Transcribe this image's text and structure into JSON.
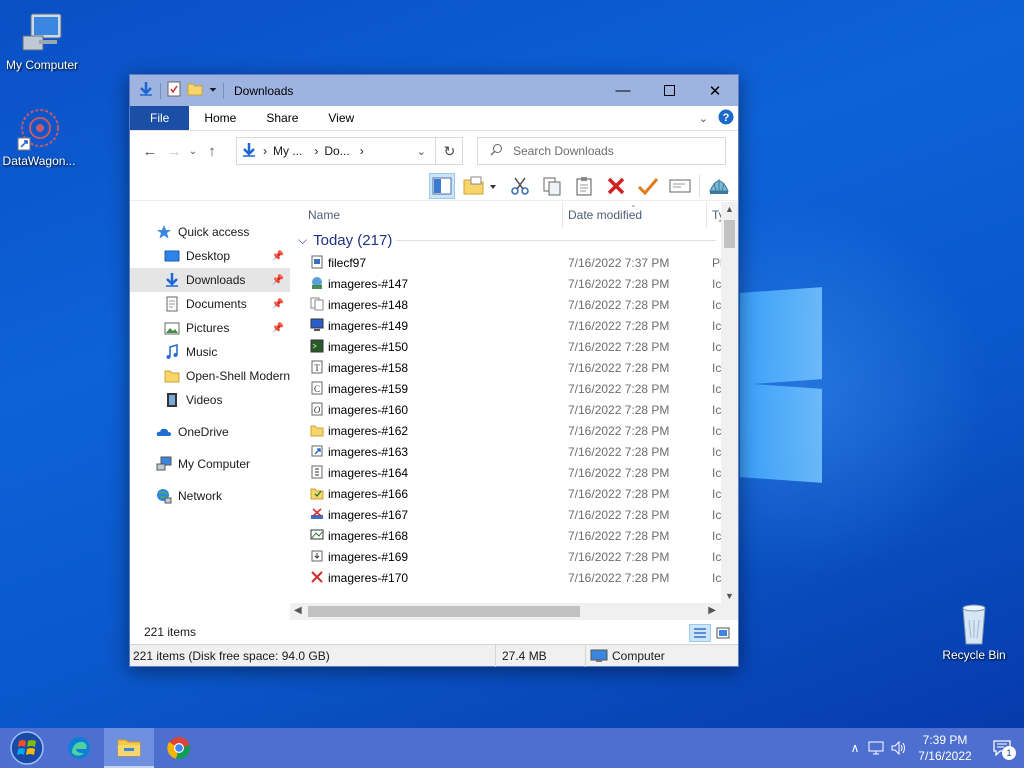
{
  "desktop": {
    "icons": [
      {
        "label": "My Computer"
      },
      {
        "label": "DataWagon..."
      },
      {
        "label": "Recycle Bin"
      }
    ]
  },
  "window": {
    "title": "Downloads",
    "ribbon_tabs": [
      "File",
      "Home",
      "Share",
      "View"
    ],
    "address": {
      "crumb1": "My ...",
      "crumb2": "Do...",
      "sep": "›"
    },
    "search_placeholder": "Search Downloads",
    "nav": {
      "quick_access": "Quick access",
      "items": [
        {
          "label": "Desktop",
          "pinned": true
        },
        {
          "label": "Downloads",
          "pinned": true
        },
        {
          "label": "Documents",
          "pinned": true
        },
        {
          "label": "Pictures",
          "pinned": true
        },
        {
          "label": "Music"
        },
        {
          "label": "Open-Shell Modern"
        },
        {
          "label": "Videos"
        }
      ],
      "onedrive": "OneDrive",
      "my_computer": "My Computer",
      "network": "Network"
    },
    "columns": {
      "name": "Name",
      "date": "Date modified",
      "type": "Ty"
    },
    "group": "Today (217)",
    "files": [
      {
        "name": "filecf97",
        "date": "7/16/2022 7:37 PM",
        "type": "Pl"
      },
      {
        "name": "imageres-#147",
        "date": "7/16/2022 7:28 PM",
        "type": "Ic"
      },
      {
        "name": "imageres-#148",
        "date": "7/16/2022 7:28 PM",
        "type": "Ic"
      },
      {
        "name": "imageres-#149",
        "date": "7/16/2022 7:28 PM",
        "type": "Ic"
      },
      {
        "name": "imageres-#150",
        "date": "7/16/2022 7:28 PM",
        "type": "Ic"
      },
      {
        "name": "imageres-#158",
        "date": "7/16/2022 7:28 PM",
        "type": "Ic"
      },
      {
        "name": "imageres-#159",
        "date": "7/16/2022 7:28 PM",
        "type": "Ic"
      },
      {
        "name": "imageres-#160",
        "date": "7/16/2022 7:28 PM",
        "type": "Ic"
      },
      {
        "name": "imageres-#162",
        "date": "7/16/2022 7:28 PM",
        "type": "Ic"
      },
      {
        "name": "imageres-#163",
        "date": "7/16/2022 7:28 PM",
        "type": "Ic"
      },
      {
        "name": "imageres-#164",
        "date": "7/16/2022 7:28 PM",
        "type": "Ic"
      },
      {
        "name": "imageres-#166",
        "date": "7/16/2022 7:28 PM",
        "type": "Ic"
      },
      {
        "name": "imageres-#167",
        "date": "7/16/2022 7:28 PM",
        "type": "Ic"
      },
      {
        "name": "imageres-#168",
        "date": "7/16/2022 7:28 PM",
        "type": "Ic"
      },
      {
        "name": "imageres-#169",
        "date": "7/16/2022 7:28 PM",
        "type": "Ic"
      },
      {
        "name": "imageres-#170",
        "date": "7/16/2022 7:28 PM",
        "type": "Ic"
      }
    ],
    "status_items": "221 items",
    "status_bar": {
      "summary": "221 items (Disk free space: 94.0 GB)",
      "size": "27.4 MB",
      "location": "Computer"
    }
  },
  "taskbar": {
    "time": "7:39 PM",
    "date": "7/16/2022",
    "notification_count": "1"
  },
  "colors": {
    "titlebar": "#9fb3e0",
    "file_tab": "#1b4fa6",
    "taskbar": "#4d6fd0",
    "group_header": "#1e3287"
  }
}
